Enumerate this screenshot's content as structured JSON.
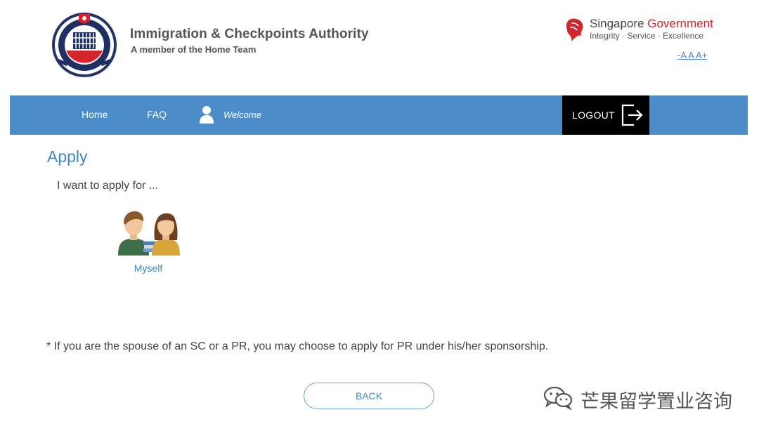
{
  "header": {
    "org_name": "Immigration & Checkpoints Authority",
    "org_sub": "A member of the Home Team",
    "crest_icon": "ica-crest-icon",
    "sg_gov_prefix": "Singapore ",
    "sg_gov_suffix": "Government",
    "sg_tagline": "Integrity · Service · Excellence",
    "font_size_control": "-A A A+"
  },
  "nav": {
    "home": "Home",
    "faq": "FAQ",
    "welcome": "Welcome",
    "logout": "LOGOUT"
  },
  "main": {
    "title": "Apply",
    "prompt": "I want to apply for ...",
    "options": [
      {
        "label": "Myself",
        "icon": "applicants-illustration-icon"
      }
    ],
    "note": "* If you are the spouse of an SC or a PR, you may choose to apply for PR under his/her sponsorship.",
    "back_label": "BACK"
  },
  "watermark": {
    "text": "芒果留学置业咨询"
  },
  "colors": {
    "nav_bg": "#4c8dc9",
    "logout_bg": "#000000",
    "accent_text": "#3f88c7",
    "gov_red": "#d0262e"
  }
}
